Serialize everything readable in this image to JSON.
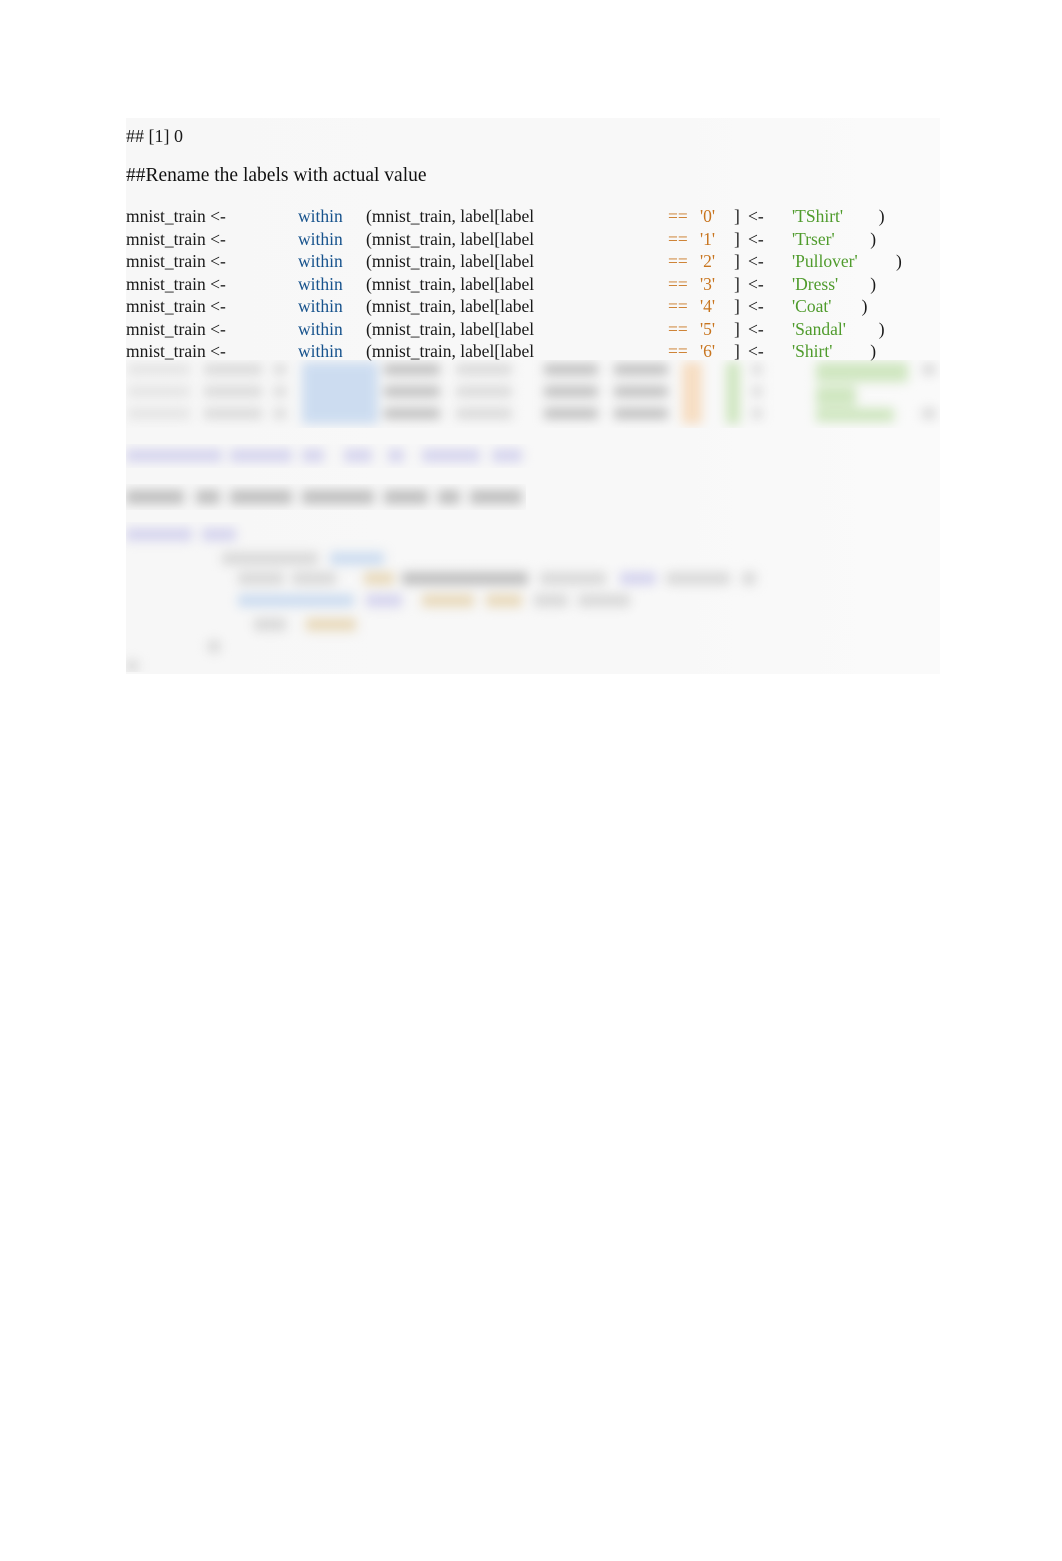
{
  "document": {
    "console_output": "## [1] 0",
    "markdown_heading": "##Rename the labels with actual value",
    "code_block": {
      "language": "R",
      "assign_target": "mnist_train <-",
      "function_name": "within",
      "args_prefix": "(mnist_train, label[label",
      "equality_operator": "==",
      "bracket_close": "]",
      "assign_arrow": "<-",
      "paren_close": ")",
      "lines": [
        {
          "target": "mnist_train <-",
          "fn": "within",
          "args": "(mnist_train, label[label",
          "op": "==",
          "num": "'0'",
          "br": "]",
          "arrow": "<-",
          "str": "'TShirt'",
          "close": ")"
        },
        {
          "target": "mnist_train <-",
          "fn": "within",
          "args": "(mnist_train, label[label",
          "op": "==",
          "num": "'1'",
          "br": "]",
          "arrow": "<-",
          "str": "'Trser'",
          "close": ")"
        },
        {
          "target": "mnist_train <-",
          "fn": "within",
          "args": "(mnist_train, label[label",
          "op": "==",
          "num": "'2'",
          "br": "]",
          "arrow": "<-",
          "str": "'Pullover'",
          "close": ")"
        },
        {
          "target": "mnist_train <-",
          "fn": "within",
          "args": "(mnist_train, label[label",
          "op": "==",
          "num": "'3'",
          "br": "]",
          "arrow": "<-",
          "str": "'Dress'",
          "close": ")"
        },
        {
          "target": "mnist_train <-",
          "fn": "within",
          "args": "(mnist_train, label[label",
          "op": "==",
          "num": "'4'",
          "br": "]",
          "arrow": "<-",
          "str": "'Coat'",
          "close": ")"
        },
        {
          "target": "mnist_train <-",
          "fn": "within",
          "args": "(mnist_train, label[label",
          "op": "==",
          "num": "'5'",
          "br": "]",
          "arrow": "<-",
          "str": "'Sandal'",
          "close": ")"
        },
        {
          "target": "mnist_train <-",
          "fn": "within",
          "args": "(mnist_train, label[label",
          "op": "==",
          "num": "'6'",
          "br": "]",
          "arrow": "<-",
          "str": "'Shirt'",
          "close": ")"
        }
      ]
    },
    "obscured_regions": [
      {
        "id": "code-continuation",
        "note": "illegible"
      },
      {
        "id": "console-line",
        "note": "illegible"
      },
      {
        "id": "section-heading",
        "note": "illegible"
      },
      {
        "id": "second-code-block",
        "note": "illegible"
      }
    ]
  },
  "colors": {
    "page_background": "#ffffff",
    "panel_background": "#f7f7f7",
    "text": "#1a1a1a",
    "keyword_blue": "#16528c",
    "operator_orange": "#c8751f",
    "string_green": "#4f9b2c"
  }
}
